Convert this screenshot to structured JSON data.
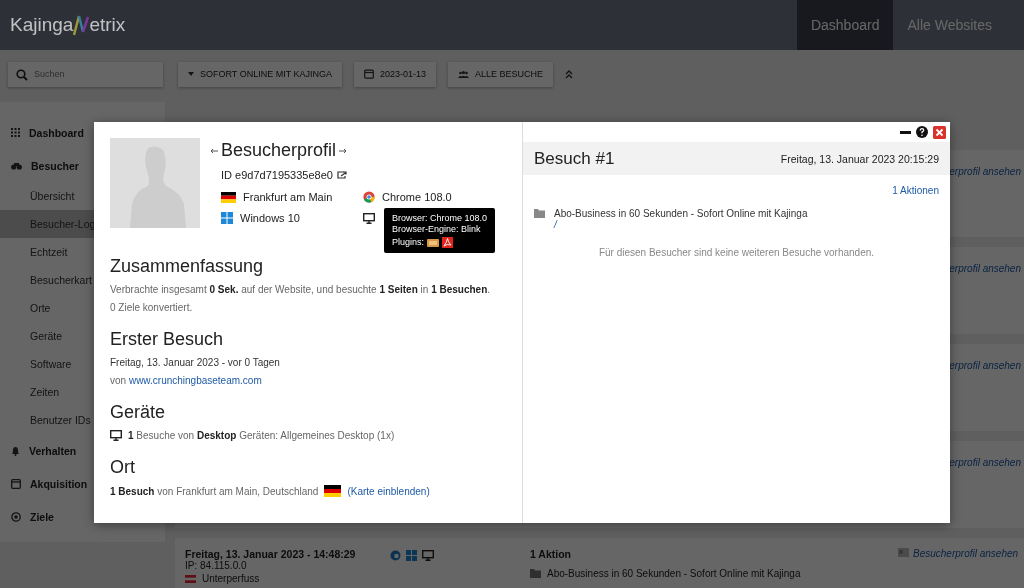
{
  "topbar": {
    "logo": {
      "before": "Kajinga",
      "after": "etrix"
    },
    "nav": [
      {
        "label": "Dashboard",
        "selected": true
      },
      {
        "label": "Alle Websites",
        "selected": false
      }
    ]
  },
  "toolbar": {
    "search": {
      "placeholder": "Suchen"
    },
    "site": "SOFORT ONLINE MIT KAJINGA",
    "date": "2023-01-13",
    "segment": "ALLE BESUCHE"
  },
  "sidebar": {
    "items": [
      {
        "kind": "section",
        "label": "Dashboard",
        "selected": false
      },
      {
        "kind": "section",
        "label": "Besucher",
        "selected": false
      },
      {
        "kind": "link",
        "label": "Übersicht",
        "selected": false
      },
      {
        "kind": "link",
        "label": "Besucher-Log",
        "selected": true
      },
      {
        "kind": "link",
        "label": "Echtzeit",
        "selected": false
      },
      {
        "kind": "link",
        "label": "Besucherkart",
        "selected": false
      },
      {
        "kind": "link",
        "label": "Orte",
        "selected": false
      },
      {
        "kind": "link",
        "label": "Geräte",
        "selected": false
      },
      {
        "kind": "link",
        "label": "Software",
        "selected": false
      },
      {
        "kind": "link",
        "label": "Zeiten",
        "selected": false
      },
      {
        "kind": "link",
        "label": "Benutzer IDs",
        "selected": false
      },
      {
        "kind": "section",
        "label": "Verhalten",
        "selected": false
      },
      {
        "kind": "section",
        "label": "Akquisition",
        "selected": false
      },
      {
        "kind": "section",
        "label": "Ziele",
        "selected": false
      }
    ]
  },
  "log": {
    "rows": [
      {
        "link": "erprofil ansehen"
      },
      {
        "link": "erprofil ansehen"
      },
      {
        "link": "erprofil ansehen"
      },
      {
        "link": "erprofil ansehen"
      }
    ],
    "last_row": {
      "datetime": "Freitag, 13. Januar 2023 - 14:48:29",
      "ip": "IP: 84.115.0.0",
      "city": "Unterperfuss",
      "actions": "1 Aktion",
      "page": "Abo-Business in 60 Sekunden - Sofort Online mit Kajinga",
      "link": "Besucherprofil ansehen"
    }
  },
  "profile": {
    "title": "Besucherprofil",
    "id": "ID e9d7d7195335e8e0",
    "city": "Frankfurt am Main",
    "browser": "Chrome 108.0",
    "os": "Windows 10",
    "tooltip": {
      "lines": [
        "Browser: Chrome 108.0",
        "Browser-Engine: Blink"
      ],
      "plugins_label": "Plugins:"
    },
    "summary": {
      "title": "Zusammenfassung",
      "lines": [
        "Verbrachte insgesamt **0 Sek.** auf der Website, und besuchte **1 Seiten** in **1 Besuchen**.",
        "0 Ziele konvertiert."
      ]
    },
    "first_visit": {
      "title": "Erster Besuch",
      "date": "Freitag, 13. Januar 2023 - vor 0 Tagen",
      "from": "von",
      "url": "www.crunchingbaseteam.com"
    },
    "devices": {
      "title": "Geräte",
      "text": "**1** Besuche von **Desktop** Geräten: Allgemeines Desktop (1x)"
    },
    "location": {
      "title": "Ort",
      "text": "**1 Besuch** von Frankfurt am Main, Deutschland",
      "map_link": "(Karte einblenden)"
    }
  },
  "visit": {
    "title": "Besuch #1",
    "datetime": "Freitag, 13. Januar 2023 20:15:29",
    "actions": "1 Aktionen",
    "page": "Abo-Business in 60 Sekunden - Sofort Online mit Kajinga",
    "path": "/",
    "empty": "Für diesen Besucher sind keine weiteren Besuche vorhanden."
  }
}
